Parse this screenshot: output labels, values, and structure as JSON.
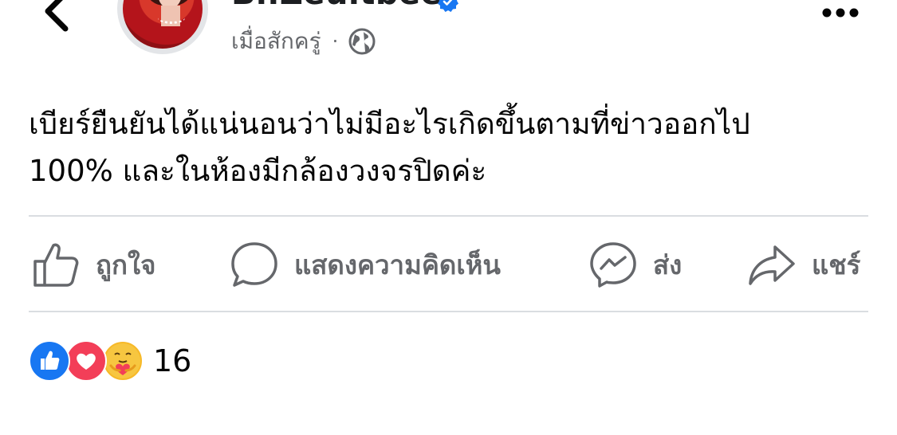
{
  "header": {
    "page_name": "Bi.Zeuitbeer",
    "timestamp": "เมื่อสักครู่",
    "separator": "·",
    "privacy_icon": "globe-icon",
    "back_icon": "chevron-left-icon",
    "more_icon": "more-horizontal-icon",
    "verified_icon": "verified-badge-icon"
  },
  "post": {
    "lines": [
      "เบียร์ยืนยันได้แน่นอนว่าไม่มีอะไรเกิดขึ้นตามที่ข่าวออกไป",
      "100% และในห้องมีกล้องวงจรปิดค่ะ"
    ]
  },
  "actions": {
    "like": {
      "label": "ถูกใจ",
      "icon": "thumbs-up-icon"
    },
    "comment": {
      "label": "แสดงความคิดเห็น",
      "icon": "comment-bubble-icon"
    },
    "send": {
      "label": "ส่ง",
      "icon": "messenger-icon"
    },
    "share": {
      "label": "แชร์",
      "icon": "share-arrow-icon"
    }
  },
  "reactions": {
    "icons": [
      "like-reaction-icon",
      "love-reaction-icon",
      "care-reaction-icon"
    ],
    "count": "16"
  },
  "colors": {
    "text_primary": "#050505",
    "text_secondary": "#65676b",
    "divider": "#dadde1",
    "verified_blue": "#1877f2",
    "like_blue": "#1877f2",
    "love_red": "#f33e58",
    "care_yellow": "#f7b928"
  }
}
